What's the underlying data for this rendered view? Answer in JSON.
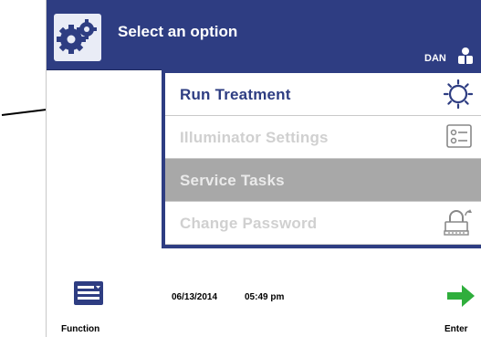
{
  "header": {
    "title": "Select an option",
    "user": "DAN"
  },
  "menu": {
    "items": [
      {
        "label": "Run Treatment",
        "state": "enabled",
        "icon": "sun-icon"
      },
      {
        "label": "Illuminator Settings",
        "state": "disabled",
        "icon": "settings-list-icon"
      },
      {
        "label": "Service Tasks",
        "state": "highlighted",
        "icon": ""
      },
      {
        "label": "Change Password",
        "state": "disabled",
        "icon": "lock-icon"
      }
    ]
  },
  "footer": {
    "function_label": "Function",
    "date": "06/13/2014",
    "time": "05:49 pm",
    "enter_label": "Enter"
  },
  "colors": {
    "primary": "#2e3d82",
    "enter_arrow": "#2fae3c",
    "disabled_text": "#d0d0d0",
    "highlight_bg": "#a8a8a8"
  }
}
